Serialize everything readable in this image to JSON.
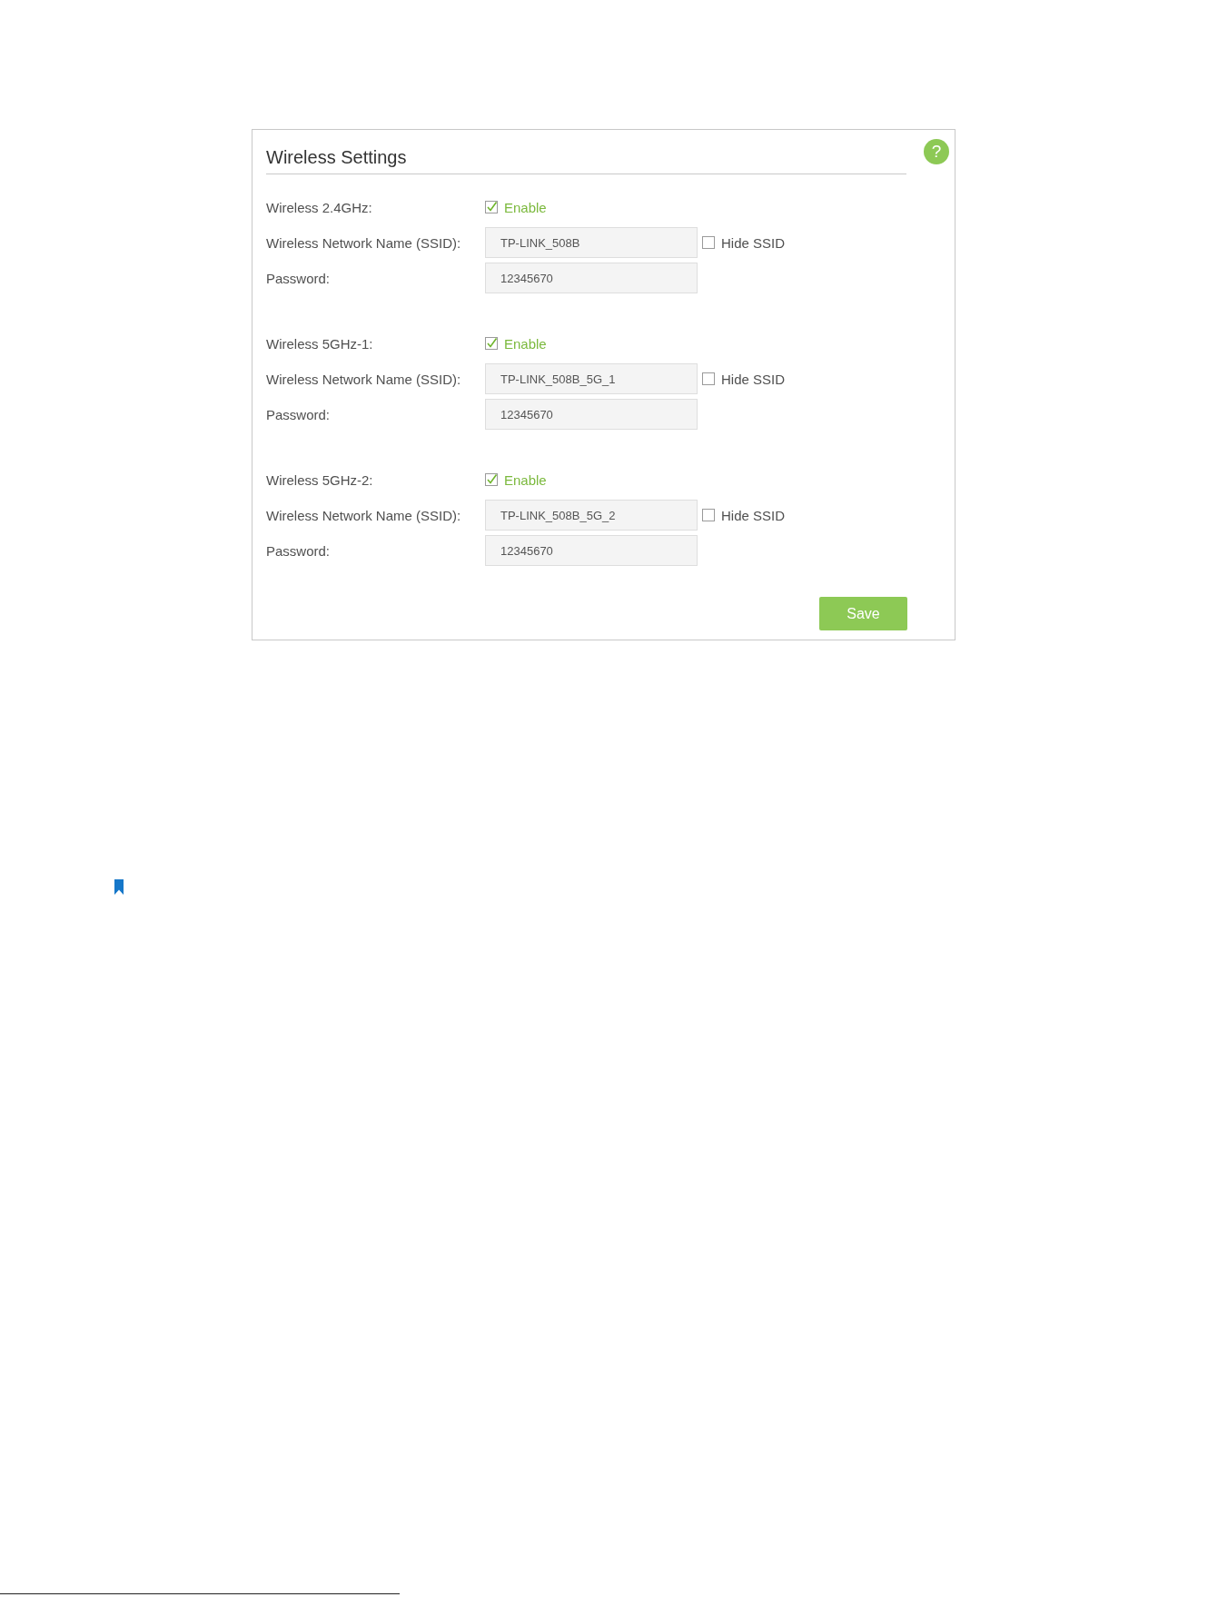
{
  "panel": {
    "title": "Wireless Settings",
    "help": "?",
    "bands": [
      {
        "label": "Wireless 2.4GHz:",
        "enable": {
          "label": "Enable",
          "checked": true
        },
        "ssid": {
          "label": "Wireless Network Name (SSID):",
          "value": "TP-LINK_508B"
        },
        "hide_ssid": {
          "label": "Hide SSID",
          "checked": false
        },
        "password": {
          "label": "Password:",
          "value": "12345670"
        }
      },
      {
        "label": "Wireless 5GHz-1:",
        "enable": {
          "label": "Enable",
          "checked": true
        },
        "ssid": {
          "label": "Wireless Network Name (SSID):",
          "value": "TP-LINK_508B_5G_1"
        },
        "hide_ssid": {
          "label": "Hide SSID",
          "checked": false
        },
        "password": {
          "label": "Password:",
          "value": "12345670"
        }
      },
      {
        "label": "Wireless 5GHz-2:",
        "enable": {
          "label": "Enable",
          "checked": true
        },
        "ssid": {
          "label": "Wireless Network Name (SSID):",
          "value": "TP-LINK_508B_5G_2"
        },
        "hide_ssid": {
          "label": "Hide SSID",
          "checked": false
        },
        "password": {
          "label": "Password:",
          "value": "12345670"
        }
      }
    ],
    "save_button": "Save"
  }
}
